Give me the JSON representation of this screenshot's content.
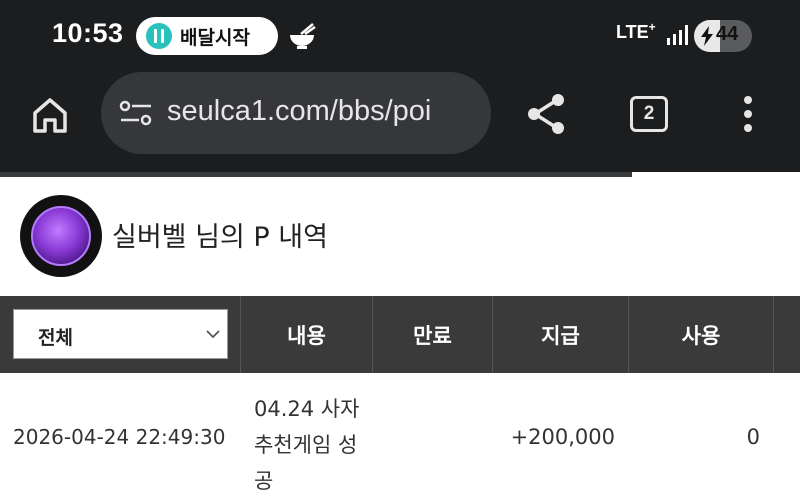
{
  "status_bar": {
    "time": "10:53",
    "pill_label": "배달시작",
    "network": "LTE",
    "battery_level": "44",
    "battery_fraction": 0.44
  },
  "browser": {
    "url": "seulca1.com/bbs/poi",
    "tab_count": "2",
    "page_load_progress": 0.79
  },
  "profile": {
    "title": "실버벨 님의 P 내역"
  },
  "table": {
    "filter_selected": "전체",
    "headers": [
      "내용",
      "만료",
      "지급",
      "사용"
    ],
    "rows": [
      {
        "datetime": "2026-04-24 22:49:30",
        "content": "04.24 사자 추천게임 성공",
        "expiry": "",
        "paid": "+200,000",
        "used": "0"
      }
    ]
  },
  "colors": {
    "chrome_bg": "#1c1d1f",
    "url_bar_bg": "#35373a",
    "table_header_bg": "#3a3a3a",
    "pill_logo": "#2ac1bc"
  }
}
